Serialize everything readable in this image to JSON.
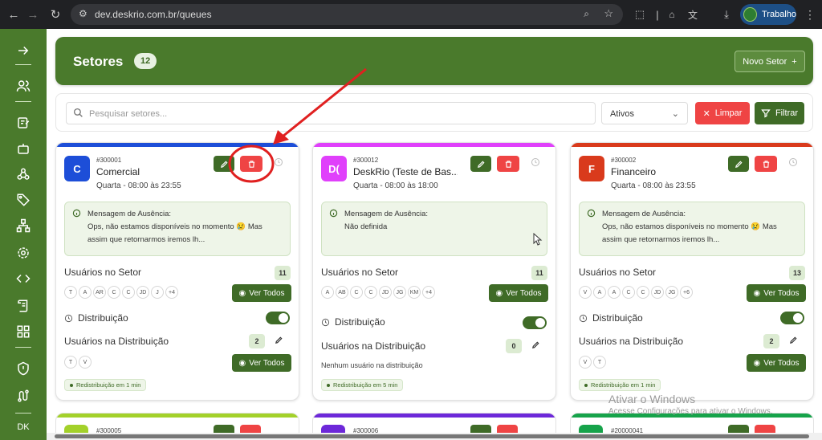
{
  "browser": {
    "url": "dev.deskrio.com.br/queues",
    "profile_name": "Trabalho"
  },
  "sidebar": {
    "icons": [
      "arrow-right-icon",
      "users-icon",
      "edit-note-icon",
      "bot-icon",
      "webhook-icon",
      "tags-icon",
      "network-icon",
      "settings-icon",
      "code-icon",
      "scroll-icon",
      "grid-icon",
      "shield-alert-icon",
      "route-icon"
    ],
    "footer_label": "DK"
  },
  "header": {
    "title": "Setores",
    "count": "12",
    "new_button": "Novo Setor"
  },
  "filters": {
    "search_placeholder": "Pesquisar setores...",
    "status_value": "Ativos",
    "clear_label": "Limpar",
    "filter_label": "Filtrar"
  },
  "cards": [
    {
      "color": "#1d4ed8",
      "avatar_color": "#1d4ed8",
      "initial": "C",
      "id": "#300001",
      "name": "Comercial",
      "hours": "Quarta - 08:00 às 23:55",
      "away_title": "Mensagem de Ausência:",
      "away_text": "Ops, não estamos disponíveis no momento 😢 Mas assim que retornarmos iremos lh...",
      "users_title": "Usuários no Setor",
      "users_count": "11",
      "users": [
        "T",
        "A",
        "AR",
        "C",
        "C",
        "JD",
        "J",
        "+4"
      ],
      "ver_todos": "Ver Todos",
      "dist_title": "Distribuição",
      "dist_users_title": "Usuários na Distribuição",
      "dist_count": "2",
      "dist_users": [
        "T",
        "V"
      ],
      "redist": "Redistribuição em 1 min"
    },
    {
      "color": "#e040fb",
      "avatar_color": "#e040fb",
      "initial": "D(",
      "id": "#300012",
      "name": "DeskRio (Teste de Bas...",
      "hours": "Quarta - 08:00 às 18:00",
      "away_title": "Mensagem de Ausência:",
      "away_text": "Não definida",
      "users_title": "Usuários no Setor",
      "users_count": "11",
      "users": [
        "A",
        "AB",
        "C",
        "C",
        "JD",
        "JG",
        "KM",
        "+4"
      ],
      "ver_todos": "Ver Todos",
      "dist_title": "Distribuição",
      "dist_users_title": "Usuários na Distribuição",
      "dist_count": "0",
      "dist_none": "Nenhum usuário na distribuição",
      "redist": "Redistribuição em 5 min"
    },
    {
      "color": "#d93a1c",
      "avatar_color": "#d93a1c",
      "initial": "F",
      "id": "#300002",
      "name": "Financeiro",
      "hours": "Quarta - 08:00 às 23:55",
      "away_title": "Mensagem de Ausência:",
      "away_text": "Ops, não estamos disponíveis no momento 😢 Mas assim que retornarmos iremos lh...",
      "users_title": "Usuários no Setor",
      "users_count": "13",
      "users": [
        "V",
        "A",
        "A",
        "C",
        "C",
        "JD",
        "JG",
        "+6"
      ],
      "ver_todos": "Ver Todos",
      "dist_title": "Distribuição",
      "dist_users_title": "Usuários na Distribuição",
      "dist_count": "2",
      "dist_users": [
        "V",
        "T"
      ],
      "redist": "Redistribuição em 1 min"
    }
  ],
  "partial_cards": [
    {
      "color": "#a3d12a",
      "id": "#300005"
    },
    {
      "color": "#6d28d9",
      "id": "#300006"
    },
    {
      "color": "#16a34a",
      "id": "#20000041"
    }
  ],
  "watermark": {
    "line1": "Ativar o Windows",
    "line2": "Acesse Configurações para ativar o Windows."
  },
  "annotation_color": "#e02020"
}
